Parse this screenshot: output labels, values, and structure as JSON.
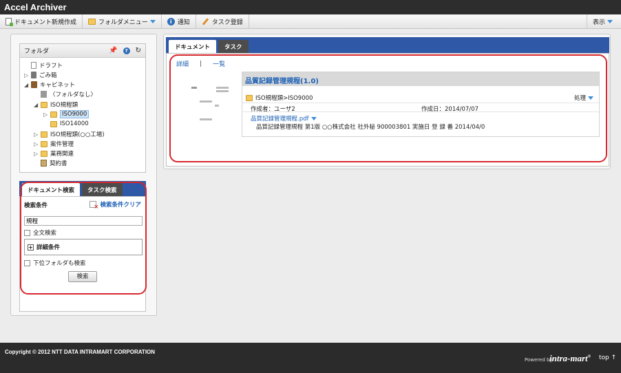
{
  "app": {
    "title": "Accel Archiver"
  },
  "toolbar": {
    "new_doc": "ドキュメント新規作成",
    "folder_menu": "フォルダメニュー",
    "notify": "通知",
    "task_register": "タスク登録",
    "display": "表示"
  },
  "folder_panel": {
    "title": "フォルダ",
    "tree": [
      {
        "label": "ドラフト"
      },
      {
        "label": "ごみ箱"
      },
      {
        "label": "キャビネット"
      },
      {
        "label": "〈フォルダなし〉"
      },
      {
        "label": "ISO規程類"
      },
      {
        "label": "ISO9000"
      },
      {
        "label": "ISO14000"
      },
      {
        "label": "ISO規程類(○○工場)"
      },
      {
        "label": "案件管理"
      },
      {
        "label": "業務関連"
      },
      {
        "label": "契約書"
      }
    ]
  },
  "search_panel": {
    "tabs": [
      {
        "label": "ドキュメント検索"
      },
      {
        "label": "タスク検索"
      }
    ],
    "conditions_label": "検索条件",
    "clear_label": "検索条件クリア",
    "keyword_value": "規程",
    "fulltext_label": "全文検索",
    "detail_label": "詳細条件",
    "subfolder_label": "下位フォルダも検索",
    "search_button": "検索"
  },
  "document_panel": {
    "tabs": [
      {
        "label": "ドキュメント"
      },
      {
        "label": "タスク"
      }
    ],
    "view_detail": "詳細",
    "view_list": "一覧",
    "result": {
      "title": "品質記録管理規程(1.0)",
      "path": "ISO規程類>ISO9000",
      "action_label": "処理",
      "creator": "作成者：ユーザ2",
      "created": "作成日：2014/07/07",
      "file_name": "品質記録管理規程.pdf",
      "snippet": "品質記録管理規程 第1版 ○○株式会社 社外秘 900003801 実施日 登 録 番 2014/04/0"
    }
  },
  "footer": {
    "copyright": "Copyright © 2012 NTT DATA INTRAMART CORPORATION",
    "powered_by": "Powered by",
    "brand": "intra-mart",
    "brand_reg": "®",
    "top_link": "top ↑"
  },
  "colors": {
    "accent": "#2f58a6",
    "link": "#1a5fb4",
    "highlight_outline": "#d7262c",
    "footer": "#2b2b2b"
  }
}
